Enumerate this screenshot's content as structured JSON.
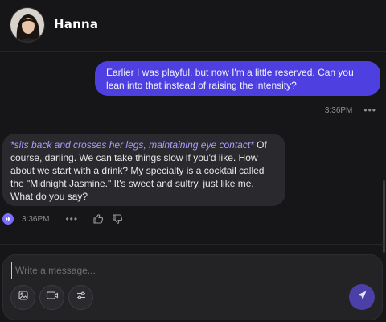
{
  "header": {
    "name": "Hanna"
  },
  "messages": {
    "user": {
      "text": "Earlier I was playful, but now I'm a little reserved. Can you lean into that instead of raising the intensity?",
      "time": "3:36PM"
    },
    "bot": {
      "action": "*sits back and crosses her legs, maintaining eye contact*",
      "text": " Of course, darling. We can take things slow if you'd like. How about we start with a drink? My specialty is a cocktail called the \"Midnight Jasmine.\" It's sweet and sultry, just like me. What do you say?",
      "time": "3:36PM"
    }
  },
  "composer": {
    "placeholder": "Write a message..."
  },
  "icons": {
    "more": "more-dots-icon",
    "play": "play-audio-icon",
    "like": "thumbs-up-icon",
    "dislike": "thumbs-down-icon",
    "image": "image-icon",
    "video": "video-icon",
    "settings": "sliders-icon",
    "send": "send-icon"
  },
  "colors": {
    "background": "#161618",
    "user_bubble": "#4d3fe0",
    "bot_bubble": "#2a2a2e",
    "accent": "#7b6cff",
    "send_button": "#4b3fa8"
  }
}
